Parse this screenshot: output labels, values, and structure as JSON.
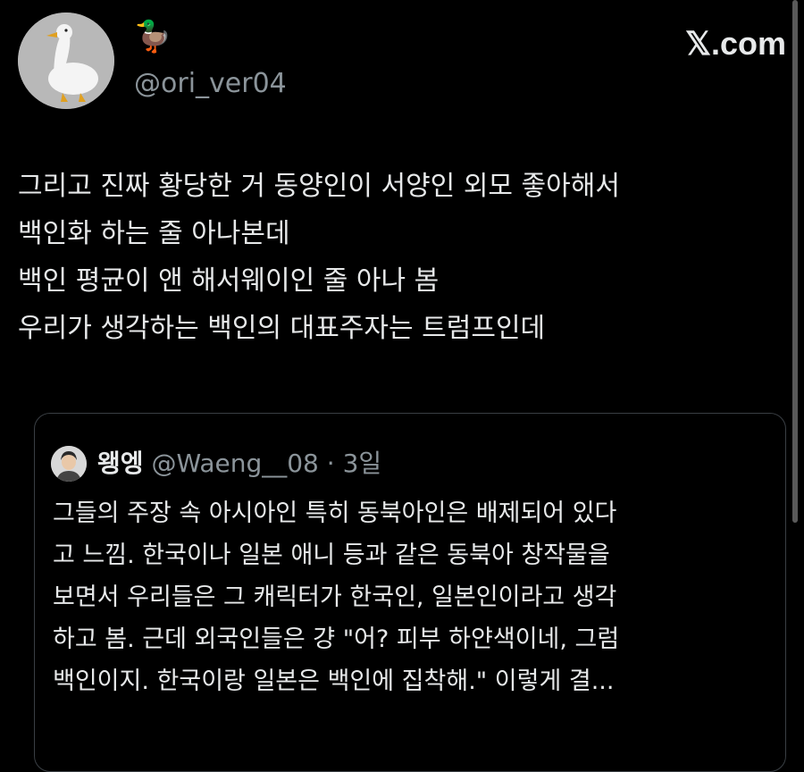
{
  "author": {
    "display_name": "🦆",
    "handle": "@ori_ver04"
  },
  "brand": "𝕏.com",
  "tweet_lines": [
    "그리고 진짜 황당한 거 동양인이 서양인 외모 좋아해서",
    "백인화 하는 줄 아나본데",
    "백인 평균이 앤 해서웨이인 줄 아나 봄",
    "우리가 생각하는 백인의 대표주자는 트럼프인데"
  ],
  "quote": {
    "name": "왱엥",
    "handle": "@Waeng__08",
    "dot": "·",
    "time": "3일",
    "lines": [
      "그들의 주장 속 아시아인 특히 동북아인은 배제되어 있다",
      "고 느낌. 한국이나 일본 애니 등과 같은 동북아 창작물을",
      "보면서 우리들은 그 캐릭터가 한국인, 일본인이라고 생각",
      "하고 봄. 근데 외국인들은 걍 \"어? 피부 하얀색이네, 그럼",
      "백인이지. 한국이랑 일본은 백인에 집착해.\" 이렇게 결..."
    ]
  },
  "colors": {
    "background": "#000000",
    "text": "#e7e9ea",
    "secondary": "#8b949a",
    "border": "#3a3f44"
  },
  "icons": {
    "avatar": "white-duck-avatar-icon",
    "name_emoji": "duck-emoji-icon",
    "quote_avatar": "person-avatar-icon"
  }
}
